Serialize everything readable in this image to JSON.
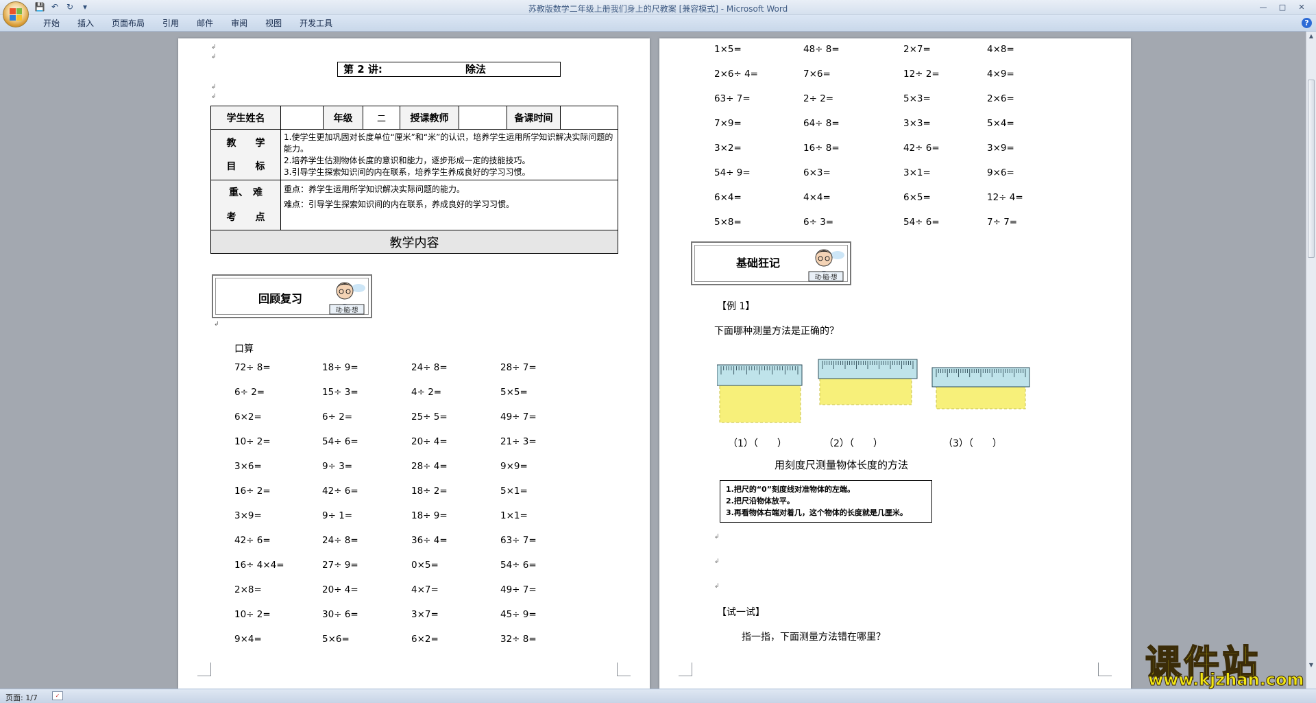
{
  "window": {
    "title": "苏教版数学二年级上册我们身上的尺教案 [兼容模式] - Microsoft Word",
    "quick_access": [
      "save-icon",
      "undo-icon",
      "redo-icon",
      "customize-icon"
    ],
    "controls": [
      "minimize",
      "maximize",
      "close"
    ]
  },
  "ribbon": {
    "tabs": [
      "开始",
      "插入",
      "页面布局",
      "引用",
      "邮件",
      "审阅",
      "视图",
      "开发工具"
    ],
    "help": "?"
  },
  "status": {
    "page": "页面: 1/7"
  },
  "left_page": {
    "lesson_no": "第 2 讲:",
    "lesson_topic": "除法",
    "info": {
      "student_label": "学生姓名",
      "grade_label": "年级",
      "grade_value": "二",
      "teacher_label": "授课教师",
      "prep_label": "备课时间",
      "goal_label_a": "教　　学",
      "goal_label_b": "目　　标",
      "goals": [
        "1.使学生更加巩固对长度单位“厘米”和“米”的认识，培养学生运用所学知识解决实际问题的能力。",
        "2.培养学生估测物体长度的意识和能力，逐步形成一定的技能技巧。",
        "3.引导学生探索知识间的内在联系，培养学生养成良好的学习习惯。"
      ],
      "key_label_a": "重、　难",
      "key_label_b": "考　　点",
      "key_point": "重点：养学生运用所学知识解决实际问题的能力。",
      "difficult_point": "难点：引导学生探索知识间的内在联系，养成良好的学习习惯。",
      "content_band": "教学内容"
    },
    "review_title": "回顾复习",
    "calc_heading": "口算",
    "calc": [
      [
        "72÷ 8=",
        "18÷ 9=",
        "24÷ 8=",
        "28÷ 7="
      ],
      [
        "6÷ 2=",
        "15÷ 3=",
        "4÷ 2=",
        "5×5="
      ],
      [
        "6×2=",
        "6÷ 2=",
        "25÷ 5=",
        "49÷ 7="
      ],
      [
        "10÷ 2=",
        "54÷ 6=",
        "20÷ 4=",
        "21÷ 3="
      ],
      [
        "3×6=",
        "9÷ 3=",
        "28÷ 4=",
        "9×9="
      ],
      [
        "16÷ 2=",
        "42÷ 6=",
        "18÷ 2=",
        "5×1="
      ],
      [
        "3×9=",
        "9÷ 1=",
        "18÷ 9=",
        "1×1="
      ],
      [
        "42÷ 6=",
        "24÷ 8=",
        "36÷ 4=",
        "63÷ 7="
      ],
      [
        "16÷ 4×4=",
        "27÷ 9=",
        "0×5=",
        "54÷ 6="
      ],
      [
        "2×8=",
        "20÷ 4=",
        "4×7=",
        "49÷ 7="
      ],
      [
        "10÷ 2=",
        "30÷ 6=",
        "3×7=",
        "45÷ 9="
      ],
      [
        "9×4=",
        "5×6=",
        "6×2=",
        "32÷ 8="
      ]
    ]
  },
  "right_page": {
    "calc": [
      [
        "1×5=",
        "48÷ 8=",
        "2×7=",
        "4×8="
      ],
      [
        "2×6÷ 4=",
        "7×6=",
        "12÷ 2=",
        "4×9="
      ],
      [
        "63÷ 7=",
        "2÷ 2=",
        "5×3=",
        "2×6="
      ],
      [
        "7×9=",
        "64÷ 8=",
        "3×3=",
        "5×4="
      ],
      [
        "3×2=",
        "16÷ 8=",
        "42÷ 6=",
        "3×9="
      ],
      [
        "54÷ 9=",
        "6×3=",
        "3×1=",
        "9×6="
      ],
      [
        "6×4=",
        "4×4=",
        "6×5=",
        "12÷ 4="
      ],
      [
        "5×8=",
        "6÷ 3=",
        "54÷ 6=",
        "7÷ 7="
      ]
    ],
    "basics_title": "基础狂记",
    "example_label": "【例 1】",
    "question": "下面哪种测量方法是正确的？",
    "ruler_choices": [
      "（1）（　　）",
      "（2）（　　）",
      "（3）（　　）"
    ],
    "method_title": "用刻度尺测量物体长度的方法",
    "method_steps": [
      "1.把尺的“0”刻度线对准物体的左端。",
      "2.把尺沿物体放平。",
      "3.再看物体右端对着几，这个物体的长度就是几厘米。"
    ],
    "try_label": "【试一试】",
    "try_question": "指一指，下面测量方法错在哪里？"
  },
  "watermark": {
    "cn": "课件站",
    "en": "www.kjzhan.com"
  },
  "colors": {
    "ribbon": "#c9d8ea",
    "workspace": "#a3a8b0",
    "ruler_fill": "#f7f07a",
    "ruler_body": "#bfe3ea",
    "watermark": "#f3e712"
  }
}
